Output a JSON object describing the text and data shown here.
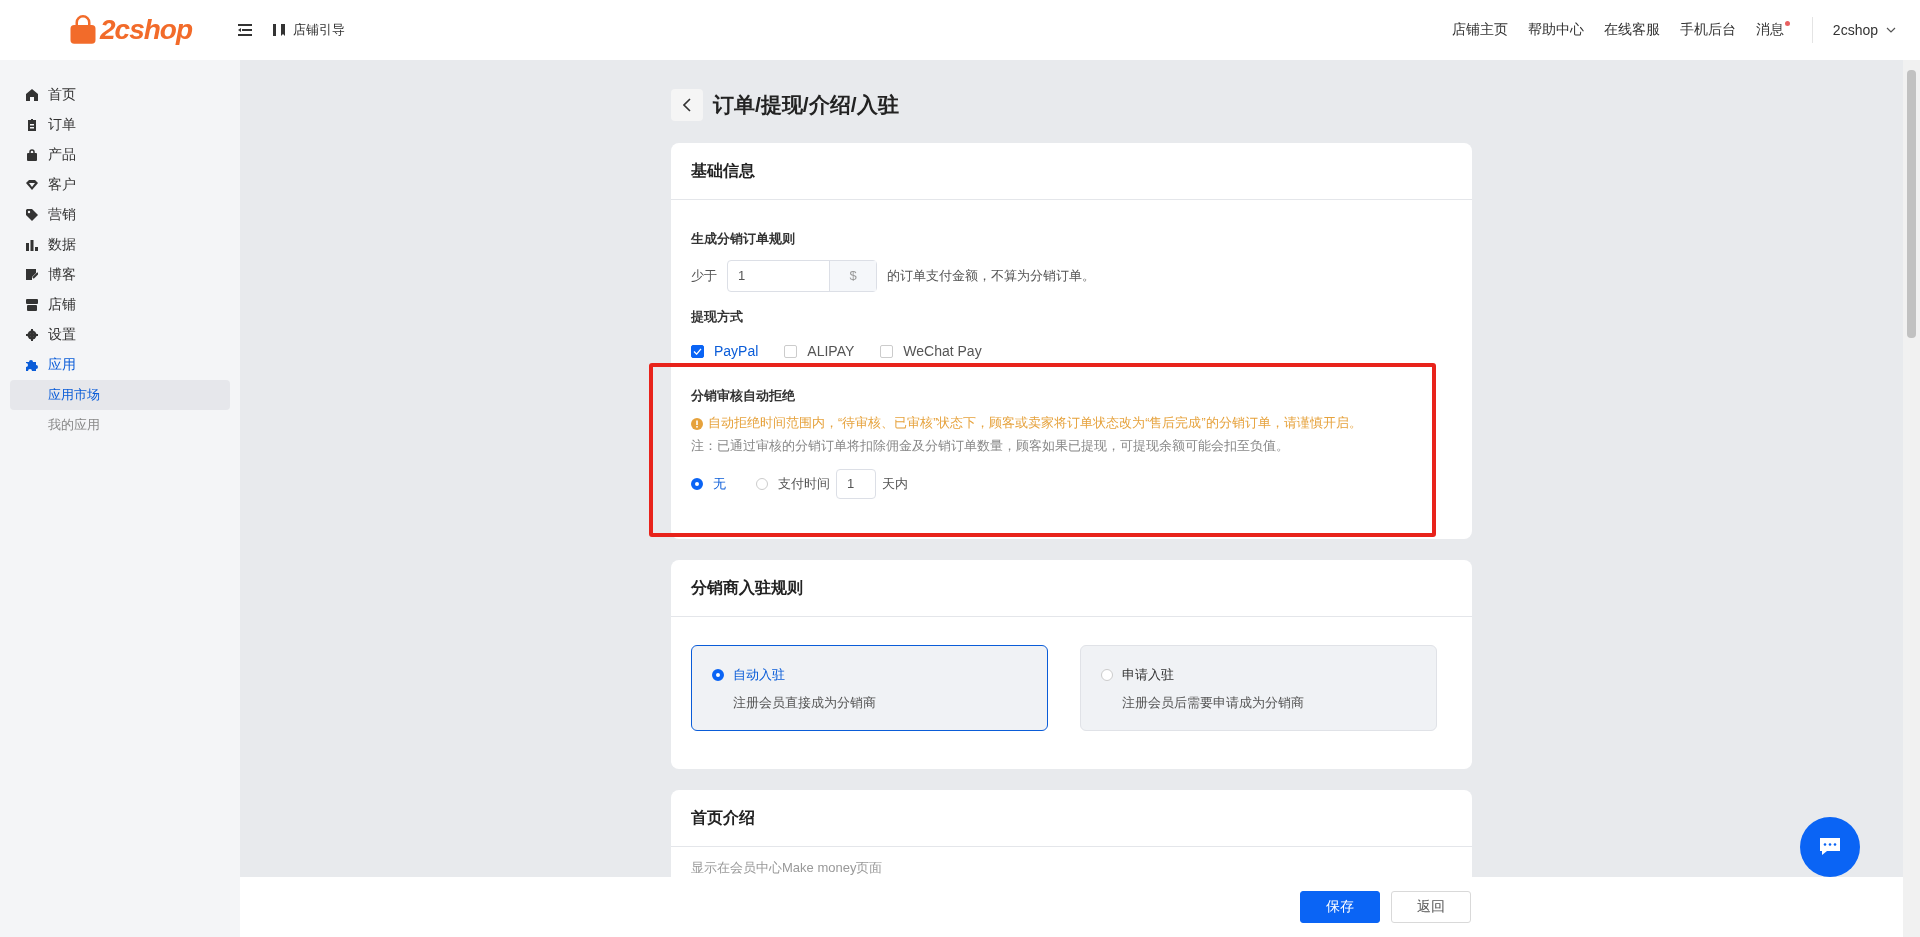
{
  "header": {
    "logo": "2cshop",
    "guide": "店铺引导",
    "links": [
      "店铺主页",
      "帮助中心",
      "在线客服",
      "手机后台"
    ],
    "messages": {
      "label": "消息",
      "unread": true
    },
    "user": "2cshop"
  },
  "sidebar": {
    "items": [
      {
        "label": "首页",
        "selected": false
      },
      {
        "label": "订单",
        "selected": false
      },
      {
        "label": "产品",
        "selected": false
      },
      {
        "label": "客户",
        "selected": false
      },
      {
        "label": "营销",
        "selected": false
      },
      {
        "label": "数据",
        "selected": false
      },
      {
        "label": "博客",
        "selected": false
      },
      {
        "label": "店铺",
        "selected": false
      },
      {
        "label": "设置",
        "selected": false
      },
      {
        "label": "应用",
        "selected": true,
        "expanded": true,
        "children": [
          {
            "label": "应用市场",
            "selected": true
          },
          {
            "label": "我的应用",
            "selected": false
          }
        ]
      }
    ]
  },
  "page_title": "订单/提现/介绍/入驻",
  "basic": {
    "title": "基础信息",
    "order_rule": {
      "label": "生成分销订单规则",
      "prefix": "少于",
      "value": "1",
      "unit": "$",
      "suffix": "的订单支付金额，不算为分销订单。"
    },
    "withdrawal": {
      "label": "提现方式",
      "options": [
        {
          "label": "PayPal",
          "checked": true
        },
        {
          "label": "ALIPAY",
          "checked": false
        },
        {
          "label": "WeChat Pay",
          "checked": false
        }
      ]
    },
    "auto_reject": {
      "label": "分销审核自动拒绝",
      "highlighted": true,
      "warning": "自动拒绝时间范围内，“待审核、已审核”状态下，顾客或卖家将订单状态改为“售后完成”的分销订单，请谨慎开启。",
      "note": "注：已通过审核的分销订单将扣除佣金及分销订单数量，顾客如果已提现，可提现余额可能会扣至负值。",
      "options": [
        {
          "kind": "plain",
          "label": "无",
          "selected": true
        },
        {
          "kind": "days",
          "label": "支付时间",
          "value": "1",
          "suffix": "天内",
          "selected": false
        }
      ]
    }
  },
  "join_rules": {
    "title": "分销商入驻规则",
    "options": [
      {
        "title": "自动入驻",
        "desc": "注册会员直接成为分销商",
        "selected": true
      },
      {
        "title": "申请入驻",
        "desc": "注册会员后需要申请成为分销商",
        "selected": false
      }
    ]
  },
  "intro": {
    "title": "首页介绍",
    "hint": "显示在会员中心Make money页面"
  },
  "footer": {
    "save": "保存",
    "back": "返回"
  }
}
